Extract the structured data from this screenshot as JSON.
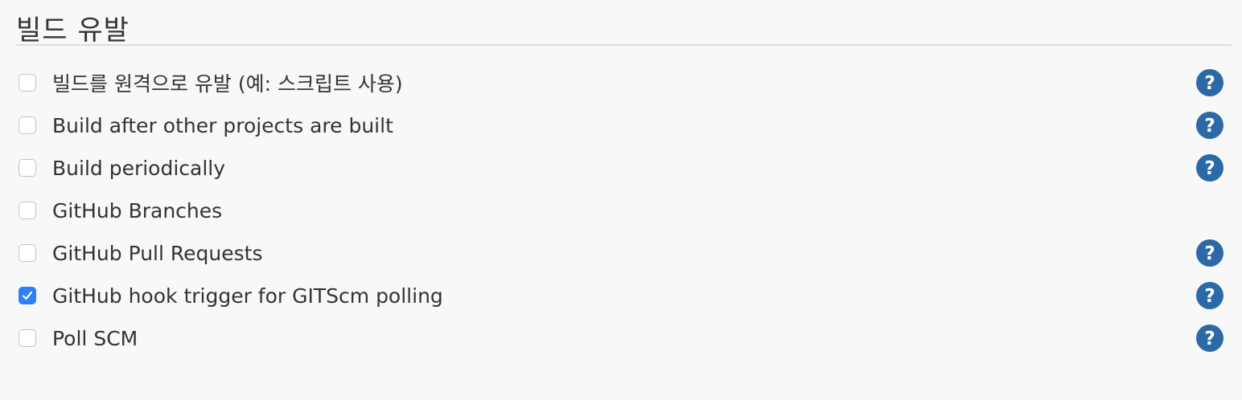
{
  "section": {
    "title": "빌드 유발"
  },
  "options": [
    {
      "label": "빌드를 원격으로 유발 (예: 스크립트 사용)",
      "checked": false,
      "has_help": true
    },
    {
      "label": "Build after other projects are built",
      "checked": false,
      "has_help": true
    },
    {
      "label": "Build periodically",
      "checked": false,
      "has_help": true
    },
    {
      "label": "GitHub Branches",
      "checked": false,
      "has_help": false
    },
    {
      "label": "GitHub Pull Requests",
      "checked": false,
      "has_help": true
    },
    {
      "label": "GitHub hook trigger for GITScm polling",
      "checked": true,
      "has_help": true
    },
    {
      "label": "Poll SCM",
      "checked": false,
      "has_help": true
    }
  ],
  "icons": {
    "help": "question-circle-icon",
    "check": "checkmark-icon"
  },
  "colors": {
    "accent": "#2f7ff7",
    "help": "#2b6aa6",
    "background": "#f8f8f8",
    "text": "#333333"
  }
}
